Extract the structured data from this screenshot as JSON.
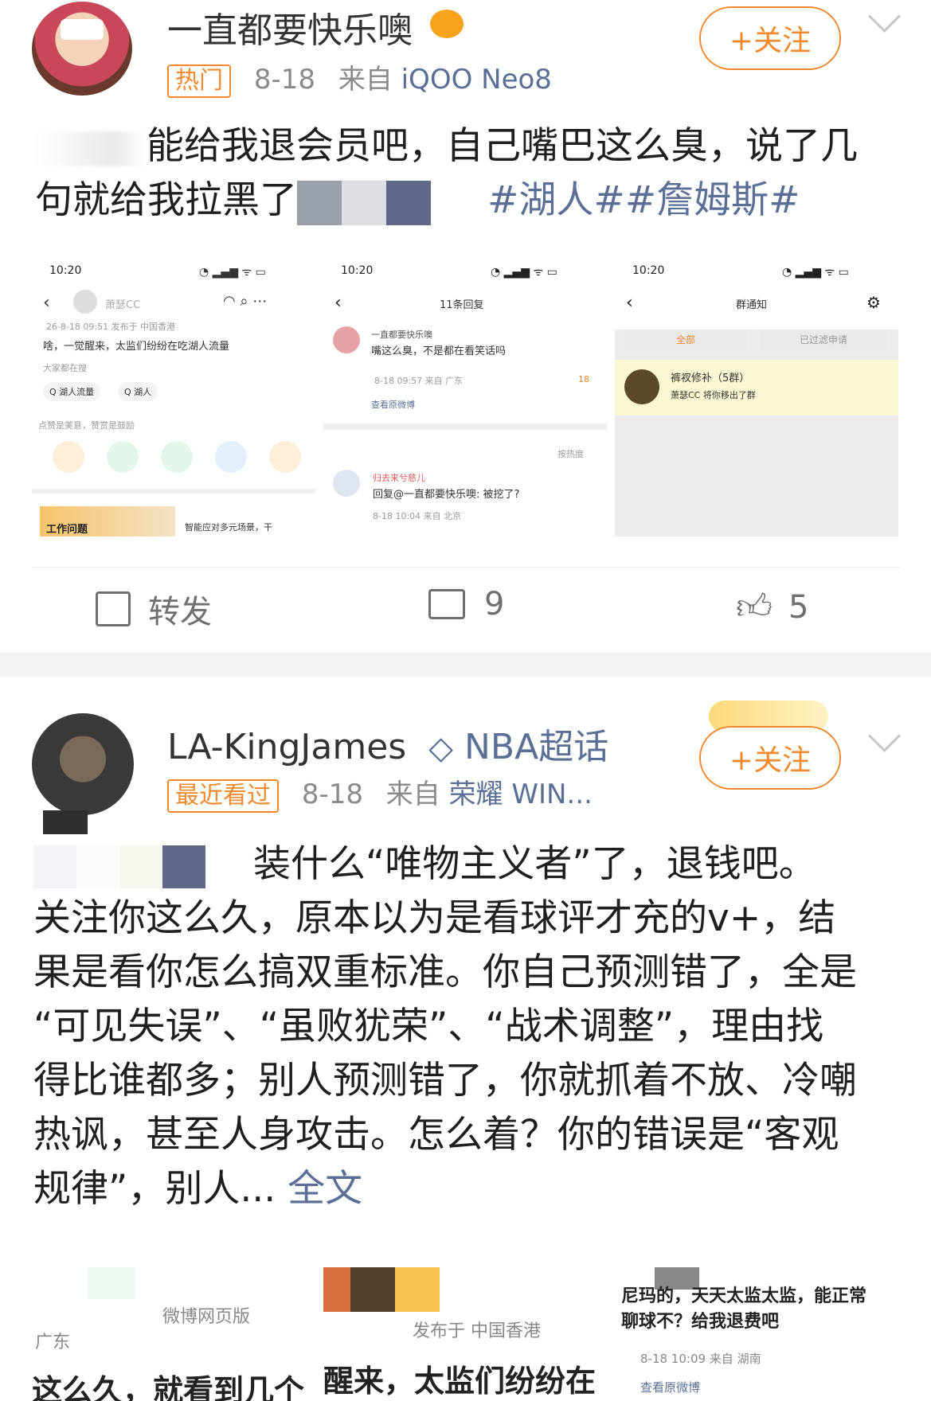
{
  "post1": {
    "username": "一直都要快乐噢",
    "badge_hot": "热门",
    "date": "8-18",
    "from_label": "来自",
    "device": "iQOO Neo8",
    "follow_label": "+关注",
    "text_line1": "能给我退会员吧，自己嘴巴这么臭，说了几",
    "text_line2_prefix": "句就给我拉黑了",
    "hashtags": "#湖人##詹姆斯#",
    "screenshots": [
      {
        "time": "10:20",
        "title": "萧瑟CC",
        "meta": "26-8-18 09:51  发布于 中国香港",
        "body": "啥，一觉醒来，太监们纷纷在吃湖人流量",
        "search_hint": "大家都在搜",
        "chip1": "Q 湖人流量",
        "chip2": "Q 湖人",
        "like_hint": "点赞是美意，赞赏是鼓励",
        "ad_text": "智能应对多元场景，干",
        "ad_label": "工作问题"
      },
      {
        "time": "10:20",
        "title": "11条回复",
        "reply_user": "一直都要快乐噢",
        "reply_text": "嘴这么臭，不是都在看笑话吗",
        "reply_meta": "8-18 09:57  来自 广东",
        "like_count": "18",
        "view_original": "查看原微博",
        "sort_label": "按热度",
        "reply2_user": "归去来兮慈儿",
        "reply2_text": "回复@一直都要快乐噢: 被挖了?",
        "reply2_meta": "8-18 10:04  来自 北京"
      },
      {
        "time": "10:20",
        "title": "群通知",
        "tab_all": "全部",
        "tab_filtered": "已过滤申请",
        "group_name": "裤衩修补（5群）",
        "notice": "萧瑟CC 将你移出了群"
      }
    ],
    "actions": {
      "repost_label": "转发",
      "comment_count": "9",
      "like_count": "5"
    }
  },
  "post2": {
    "username": "LA-KingJames",
    "topic": "NBA超话",
    "badge_recent": "最近看过",
    "date": "8-18",
    "from_label": "来自",
    "device": "荣耀 WIN...",
    "follow_label": "+关注",
    "lines": [
      "装什么“唯物主义者”了，退钱吧。",
      "关注你这么久，原本以为是看球评才充的v+，结",
      "果是看你怎么搞双重标准。你自己预测错了，全是",
      "“可见失误”、“虽败犹荣”、“战术调整”，理由找",
      "得比谁都多；别人预测错了，你就抓着不放、冷嘲",
      "热讽，甚至人身攻击。怎么着？你的错误是“客观",
      "规律”，别人..."
    ],
    "full_text_link": "全文",
    "thumbs": [
      {
        "source": "微博网页版",
        "region": "广东",
        "snippet": "这么久，就看到几个"
      },
      {
        "meta": "发布于 中国香港",
        "snippet": "醒来，太监们纷纷在"
      },
      {
        "line1": "尼玛的，天天太监太监，能正常",
        "line2": "聊球不？给我退费吧",
        "meta": "8-18 10:09  来自 湖南",
        "view_original": "查看原微博"
      }
    ]
  },
  "colors": {
    "accent_orange": "#f08a2c",
    "link_blue": "#5b6f96",
    "divider_gray": "#f2f2f2"
  }
}
